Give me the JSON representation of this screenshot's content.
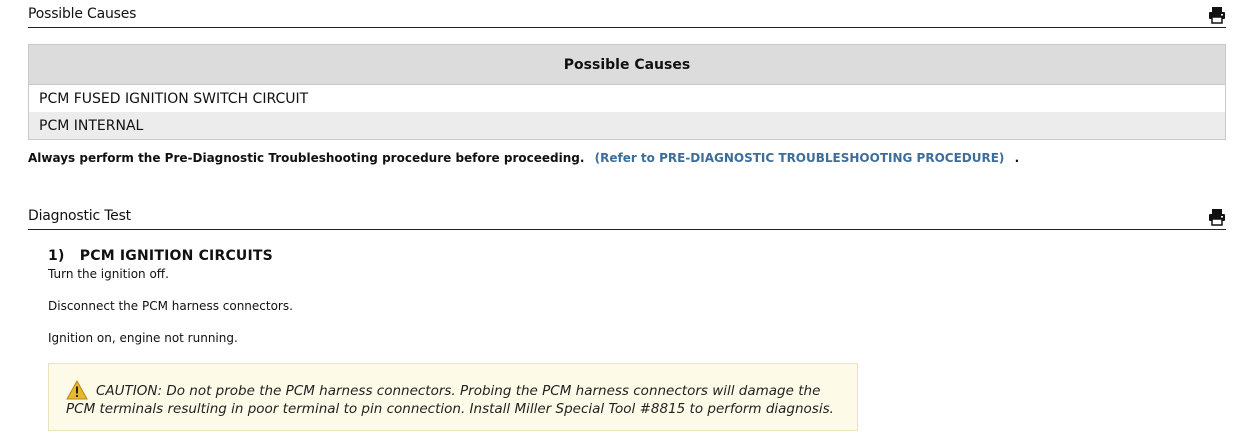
{
  "possible_causes_section": {
    "title": "Possible Causes",
    "table_header": "Possible Causes",
    "rows": [
      "PCM FUSED IGNITION SWITCH CIRCUIT",
      "PCM INTERNAL"
    ]
  },
  "pre_diagnostic_note": {
    "text": "Always perform the Pre-Diagnostic Troubleshooting procedure before proceeding.",
    "link": "(Refer to PRE-DIAGNOSTIC TROUBLESHOOTING PROCEDURE)",
    "trailing": "."
  },
  "diagnostic_test_section": {
    "title": "Diagnostic Test",
    "step_title": "1)   PCM IGNITION CIRCUITS",
    "steps": [
      "Turn the ignition off.",
      "Disconnect the PCM harness connectors.",
      "Ignition on, engine not running."
    ],
    "caution": "CAUTION: Do not probe the PCM harness connectors. Probing the PCM harness connectors will damage the PCM terminals resulting in poor terminal to pin connection. Install Miller Special Tool #8815 to perform diagnosis."
  },
  "icons": {
    "print": "print-icon",
    "caution": "warning-triangle-icon"
  },
  "colors": {
    "link": "#3d6e9b",
    "table_header_bg": "#dcdcdc",
    "caution_bg": "#fdfbe8",
    "caution_icon": "#e8b830"
  }
}
